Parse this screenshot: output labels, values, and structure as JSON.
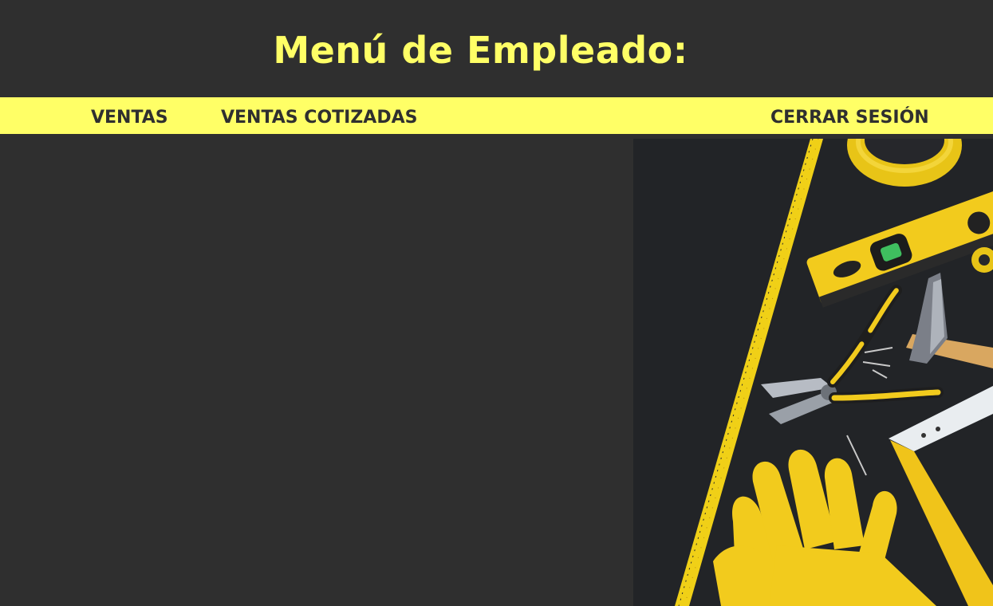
{
  "header": {
    "title": "Menú de Empleado:"
  },
  "nav": {
    "items": [
      {
        "label": "VENTAS"
      },
      {
        "label": "VENTAS COTIZADAS"
      }
    ],
    "logout": "CERRAR SESIÓN"
  },
  "image": {
    "subject": "tools-on-dark-surface"
  },
  "colors": {
    "background": "#2f2f2f",
    "accent": "#ffff66",
    "nav_text": "#2f2f2f"
  }
}
